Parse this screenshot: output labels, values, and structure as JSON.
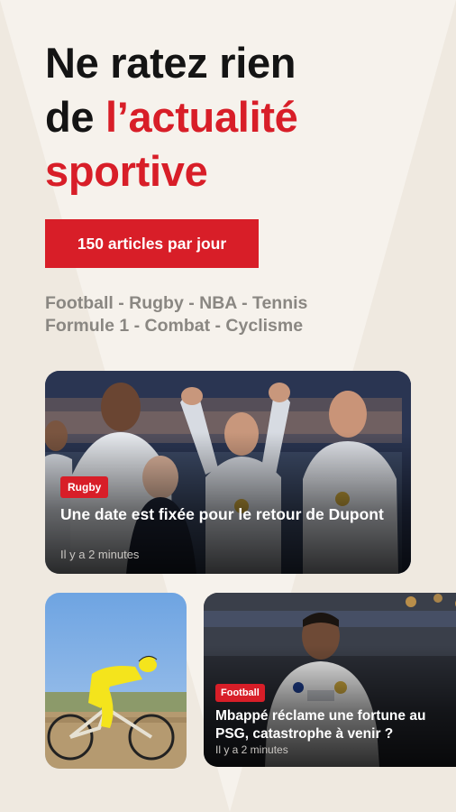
{
  "headline": {
    "line1": "Ne ratez rien",
    "line2_prefix": "de ",
    "line2_highlight": "l’actualité",
    "line3_highlight": "sportive"
  },
  "cta": {
    "label": "150 articles par jour"
  },
  "sports": {
    "line1": "Football - Rugby - NBA - Tennis",
    "line2": "Formule 1 - Combat - Cyclisme"
  },
  "articles": [
    {
      "tag": "Rugby",
      "title": "Une date est fixée pour le retour de Dupont",
      "time": "Il y a 2 minutes"
    },
    {
      "tag": "",
      "title": "",
      "time": ""
    },
    {
      "tag": "Football",
      "title": "Mbappé réclame une fortune au PSG, catastrophe à venir ?",
      "time": "Il y a 2 minutes"
    }
  ],
  "colors": {
    "accent": "#d81e28",
    "background": "#efe9e0",
    "wedge": "#f6f2ec",
    "headline": "#141414",
    "muted": "#8a8782"
  }
}
